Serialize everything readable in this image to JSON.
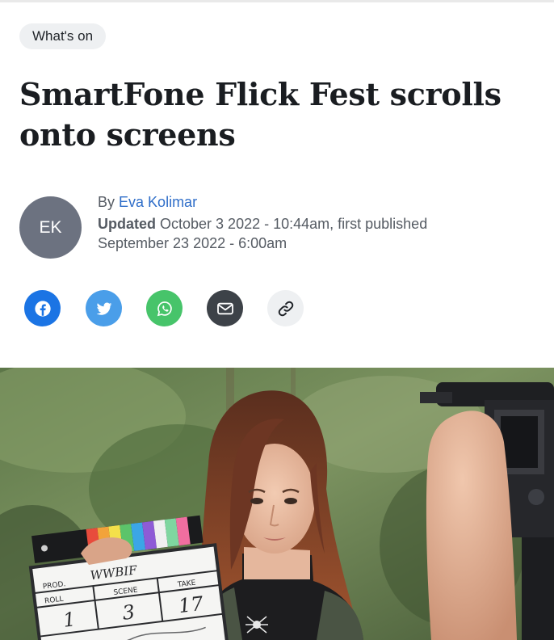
{
  "category_tag": "What's on",
  "headline": "SmartFone Flick Fest scrolls onto screens",
  "author": {
    "initials": "EK",
    "by_prefix": "By",
    "name": "Eva Kolimar"
  },
  "dates": {
    "updated_label": "Updated",
    "updated_value": "October 3 2022 - 10:44am, first published",
    "published_value": "September 23 2022 - 6:00am"
  },
  "share_buttons": [
    {
      "name": "facebook",
      "icon": "facebook-icon",
      "color": "#1b74e4"
    },
    {
      "name": "twitter",
      "icon": "twitter-icon",
      "color": "#4a9ee9"
    },
    {
      "name": "whatsapp",
      "icon": "whatsapp-icon",
      "color": "#47c46a"
    },
    {
      "name": "email",
      "icon": "mail-icon",
      "color": "#3d4248"
    },
    {
      "name": "copy-link",
      "icon": "link-icon",
      "color": "#eef0f2"
    }
  ],
  "hero_image": {
    "clapperboard": {
      "title": "WWBIF",
      "prod_label": "PROD.",
      "roll_label": "ROLL",
      "scene_label": "SCENE",
      "take_label": "TAKE",
      "roll_value": "1",
      "scene_value": "3",
      "take_value": "17"
    }
  }
}
